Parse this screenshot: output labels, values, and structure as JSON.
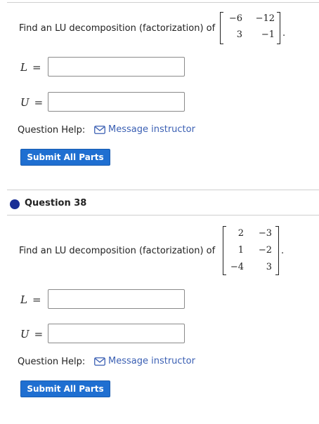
{
  "question_37": {
    "prompt": "Find an LU decomposition (factorization) of",
    "matrix": [
      [
        "−6",
        "−12"
      ],
      [
        "3",
        "−1"
      ]
    ],
    "period": ".",
    "l_label": "L",
    "u_label": "U",
    "equals": "=",
    "l_value": "",
    "u_value": "",
    "help_label": "Question Help:",
    "help_link": "Message instructor",
    "submit_label": "Submit All Parts"
  },
  "question_38": {
    "title": "Question 38",
    "prompt": "Find an LU decomposition (factorization) of",
    "matrix": [
      [
        "2",
        "−3"
      ],
      [
        "1",
        "−2"
      ],
      [
        "−4",
        "3"
      ]
    ],
    "period": ".",
    "l_label": "L",
    "u_label": "U",
    "equals": "=",
    "l_value": "",
    "u_value": "",
    "help_label": "Question Help:",
    "help_link": "Message instructor",
    "submit_label": "Submit All Parts"
  },
  "colors": {
    "accent": "#1f6fd1",
    "link": "#3a5fb3",
    "question_dot": "#1a2f96",
    "divider": "#cfcfcf"
  },
  "icons": {
    "help_link_icon": "envelope-icon"
  }
}
